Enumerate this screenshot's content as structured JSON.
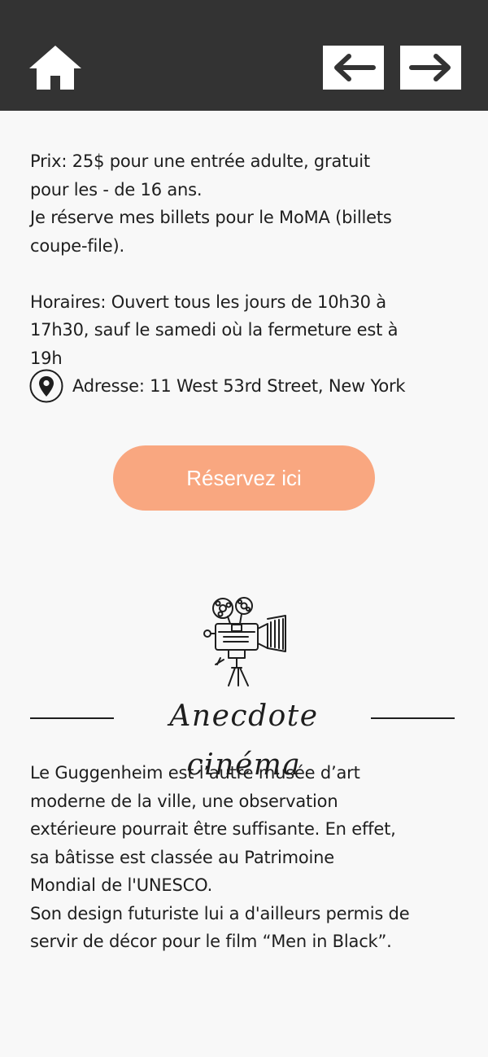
{
  "header": {
    "home_icon": "home-icon",
    "back_icon": "arrow-left-icon",
    "next_icon": "arrow-right-icon",
    "background": "#333333"
  },
  "info": {
    "lines": [
      "Prix: 25$ pour une entrée adulte, gratuit",
      "pour les - de 16 ans.",
      "Je réserve mes billets pour le MoMA (billets",
      "coupe-file).",
      "Horaires: Ouvert tous les jours de 10h30 à",
      "17h30, sauf le samedi où la fermeture est à",
      "19h"
    ],
    "address_icon": "location-pin-icon",
    "address": "Adresse: 11 West 53rd Street, New York"
  },
  "reserve": {
    "label": "Réservez ici",
    "color": "#f9a780"
  },
  "anecdote": {
    "illustration": "film-camera-icon",
    "title": "Anecdote cinéma",
    "lines": [
      "Le Guggenheim est l’autre musée d’art",
      "moderne de la ville, une observation",
      "extérieure pourrait être suffisante. En effet,",
      "sa bâtisse est classée au Patrimoine",
      "Mondial de l'UNESCO.",
      "Son design futuriste lui a d'ailleurs permis de",
      "servir de décor pour le film “Men in Black”."
    ]
  }
}
